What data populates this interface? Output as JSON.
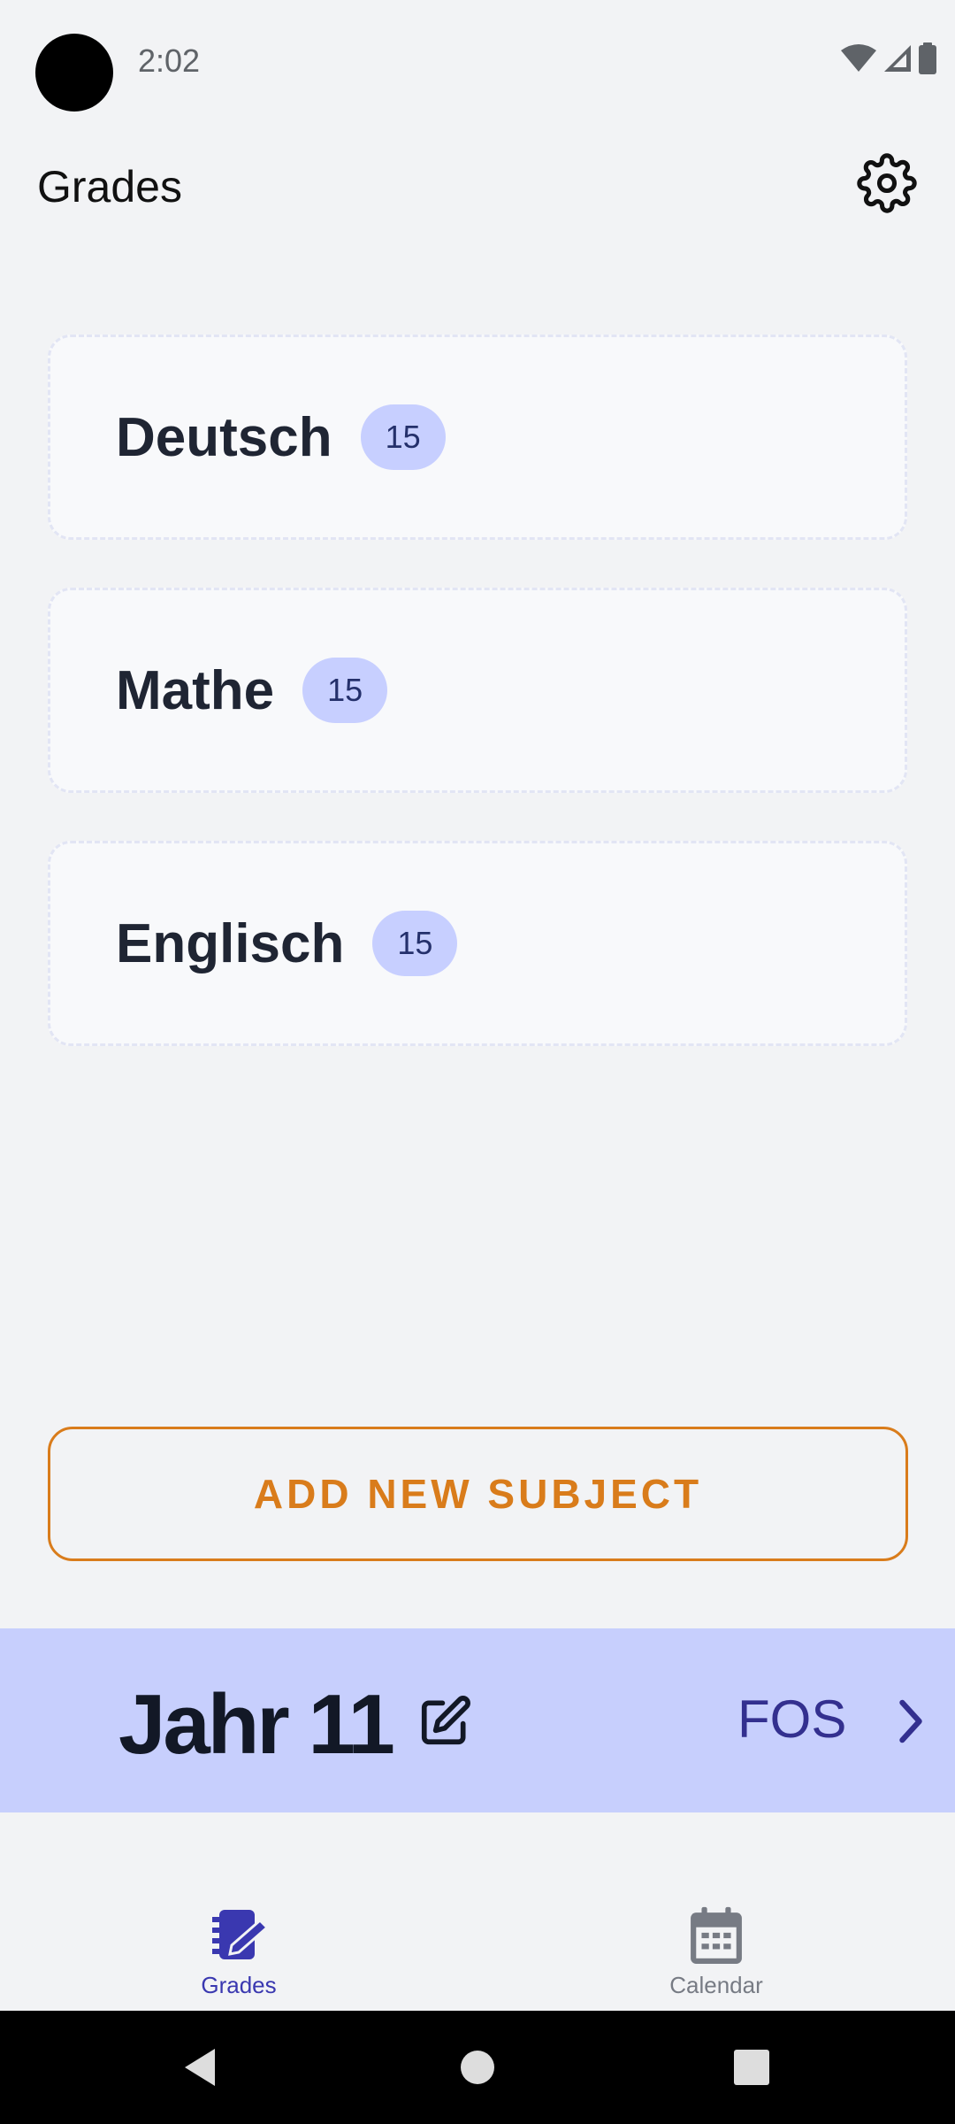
{
  "status_bar": {
    "time": "2:02",
    "icons": [
      "wifi-icon",
      "signal-icon",
      "battery-icon"
    ]
  },
  "app_bar": {
    "title": "Grades",
    "settings_icon": "gear-icon"
  },
  "subjects": [
    {
      "name": "Deutsch",
      "badge": "15"
    },
    {
      "name": "Mathe",
      "badge": "15"
    },
    {
      "name": "Englisch",
      "badge": "15"
    }
  ],
  "add_button_label": "ADD NEW SUBJECT",
  "year_banner": {
    "title": "Jahr 11",
    "school_type": "FOS",
    "edit_icon": "edit-icon",
    "next_icon": "chevron-right-icon"
  },
  "bottom_nav": {
    "items": [
      {
        "label": "Grades",
        "icon": "grades-icon",
        "active": true
      },
      {
        "label": "Calendar",
        "icon": "calendar-icon",
        "active": false
      }
    ]
  },
  "system_nav": {
    "icons": [
      "back-icon",
      "home-icon",
      "recents-icon"
    ]
  },
  "colors": {
    "background": "#f2f3f5",
    "accent_orange": "#d97c1b",
    "badge_bg": "#c7cfff",
    "banner_bg": "#c7cffd",
    "primary_indigo": "#3a38b0"
  }
}
